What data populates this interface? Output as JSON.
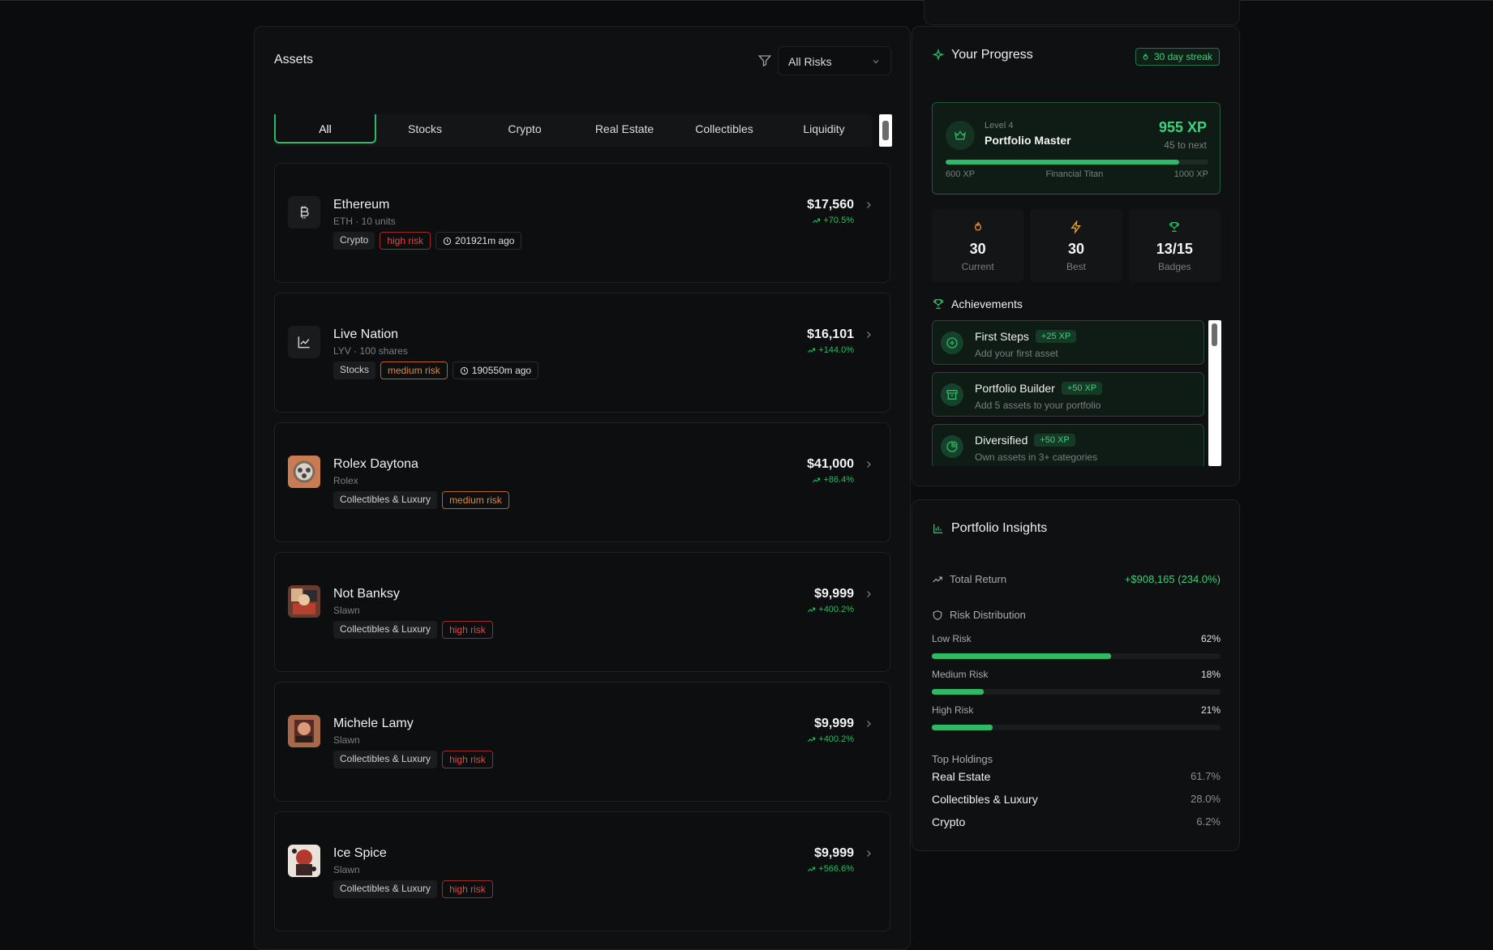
{
  "assets": {
    "title": "Assets",
    "risk_filter": "All Risks",
    "tabs": [
      "All",
      "Stocks",
      "Crypto",
      "Real Estate",
      "Collectibles",
      "Liquidity"
    ],
    "items": [
      {
        "name": "Ethereum",
        "sub": "ETH · 10 units",
        "category": "Crypto",
        "risk": "high risk",
        "risk_level": "high",
        "time": "201921m ago",
        "value": "$17,560",
        "change": "+70.5%",
        "icon": "bitcoin-icon"
      },
      {
        "name": "Live Nation",
        "sub": "LYV · 100 shares",
        "category": "Stocks",
        "risk": "medium risk",
        "risk_level": "medium",
        "time": "190550m ago",
        "value": "$16,101",
        "change": "+144.0%",
        "icon": "chart-line-icon"
      },
      {
        "name": "Rolex Daytona",
        "sub": "Rolex",
        "category": "Collectibles & Luxury",
        "risk": "medium risk",
        "risk_level": "medium",
        "time": "",
        "value": "$41,000",
        "change": "+86.4%",
        "icon": "watch-photo"
      },
      {
        "name": "Not Banksy",
        "sub": "Slawn",
        "category": "Collectibles & Luxury",
        "risk": "high risk",
        "risk_level": "high",
        "time": "",
        "value": "$9,999",
        "change": "+400.2%",
        "icon": "art-photo"
      },
      {
        "name": "Michele Lamy",
        "sub": "Slawn",
        "category": "Collectibles & Luxury",
        "risk": "high risk",
        "risk_level": "high",
        "time": "",
        "value": "$9,999",
        "change": "+400.2%",
        "icon": "art-photo"
      },
      {
        "name": "Ice Spice",
        "sub": "Slawn",
        "category": "Collectibles & Luxury",
        "risk": "high risk",
        "risk_level": "high",
        "time": "",
        "value": "$9,999",
        "change": "+566.6%",
        "icon": "art-photo"
      }
    ]
  },
  "progress": {
    "title": "Your Progress",
    "streak": "30 day streak",
    "level_label": "Level 4",
    "level_name": "Portfolio Master",
    "xp": "955 XP",
    "xp_next": "45 to next",
    "xp_fraction": 0.8875,
    "xp_min": "600 XP",
    "next_level": "Financial Titan",
    "xp_max": "1000 XP",
    "stats": [
      {
        "value": "30",
        "label": "Current",
        "icon": "flame-icon"
      },
      {
        "value": "30",
        "label": "Best",
        "icon": "bolt-icon"
      },
      {
        "value": "13/15",
        "label": "Badges",
        "icon": "trophy-icon"
      }
    ],
    "achievements_title": "Achievements",
    "achievements": [
      {
        "title": "First Steps",
        "xp": "+25 XP",
        "desc": "Add your first asset",
        "icon": "plus-circle-icon"
      },
      {
        "title": "Portfolio Builder",
        "xp": "+50 XP",
        "desc": "Add 5 assets to your portfolio",
        "icon": "archive-icon"
      },
      {
        "title": "Diversified",
        "xp": "+50 XP",
        "desc": "Own assets in 3+ categories",
        "icon": "pie-chart-icon"
      }
    ]
  },
  "insights": {
    "title": "Portfolio Insights",
    "total_return_label": "Total Return",
    "total_return": "+$908,165 (234.0%)",
    "risk_title": "Risk Distribution",
    "risks": [
      {
        "label": "Low Risk",
        "pct": "62%",
        "value": 62
      },
      {
        "label": "Medium Risk",
        "pct": "18%",
        "value": 18
      },
      {
        "label": "High Risk",
        "pct": "21%",
        "value": 21
      }
    ],
    "holdings_title": "Top Holdings",
    "holdings": [
      {
        "name": "Real Estate",
        "pct": "61.7%"
      },
      {
        "name": "Collectibles & Luxury",
        "pct": "28.0%"
      },
      {
        "name": "Crypto",
        "pct": "6.2%"
      }
    ]
  },
  "colors": {
    "accent": "#2fb866",
    "high_risk": "#e04848",
    "medium_risk": "#e5883a",
    "background": "#0b0c0d"
  }
}
